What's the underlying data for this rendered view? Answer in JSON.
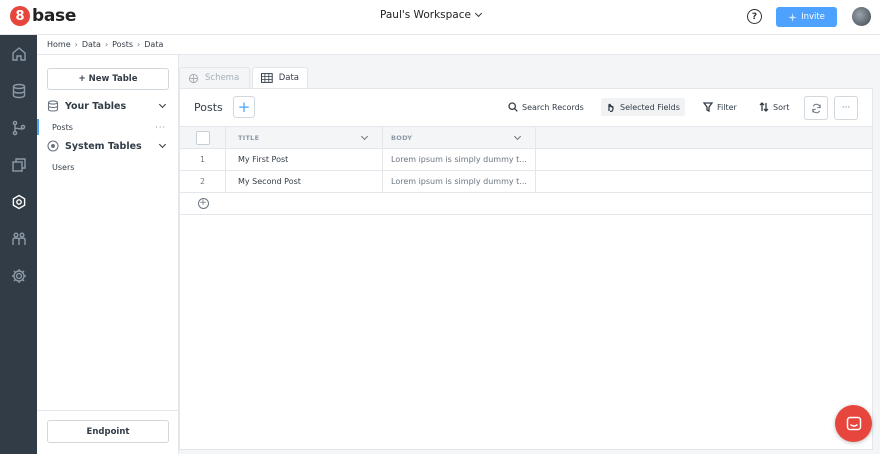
{
  "brand": {
    "logo_letter": "8",
    "logo_text": "base",
    "accent": "#e6463c",
    "primary": "#4da1ff",
    "nav_bg": "#323c47"
  },
  "header": {
    "workspace": "Paul's Workspace",
    "help": "?",
    "invite_label": "Invite"
  },
  "breadcrumb": [
    "Home",
    "Data",
    "Posts",
    "Data"
  ],
  "leftnav": [
    "home-icon",
    "database-icon",
    "branch-icon",
    "layers-icon",
    "settings-network-icon",
    "team-icon",
    "gear-icon"
  ],
  "tables_panel": {
    "new_table_label": "+ New Table",
    "your_tables_label": "Your Tables",
    "your_tables": [
      {
        "label": "Posts",
        "more": "···"
      }
    ],
    "system_tables_label": "System Tables",
    "system_tables": [
      {
        "label": "Users"
      }
    ],
    "endpoint_label": "Endpoint"
  },
  "tabs": [
    {
      "label": "Schema",
      "active": false
    },
    {
      "label": "Data",
      "active": true
    }
  ],
  "toolbar": {
    "title": "Posts",
    "add_label": "+",
    "search_label": "Search Records",
    "selected_fields_label": "Selected Fields",
    "filter_label": "Filter",
    "sort_label": "Sort",
    "more_label": "···"
  },
  "grid": {
    "columns": [
      "TITLE",
      "BODY"
    ],
    "rows": [
      {
        "num": "1",
        "title": "My First Post",
        "body": "Lorem ipsum is simply dummy t..."
      },
      {
        "num": "2",
        "title": "My Second Post",
        "body": "Lorem ipsum is simply dummy t..."
      }
    ],
    "add_row": "+"
  }
}
